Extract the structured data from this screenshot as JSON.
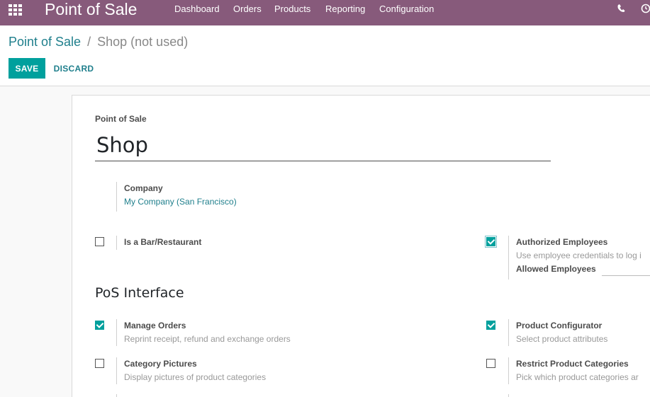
{
  "navbar": {
    "brand": "Point of Sale",
    "menu": [
      "Dashboard",
      "Orders",
      "Products",
      "Reporting",
      "Configuration"
    ],
    "icons": [
      "apps-grid-icon",
      "phone-icon",
      "clock-icon"
    ]
  },
  "breadcrumb": {
    "parent": "Point of Sale",
    "separator": "/",
    "current": "Shop (not used)"
  },
  "actions": {
    "save": "SAVE",
    "discard": "DISCARD"
  },
  "form": {
    "name_label": "Point of Sale",
    "name_value": "Shop",
    "company_label": "Company",
    "company_value": "My Company (San Francisco)",
    "bar_restaurant": {
      "label": "Is a Bar/Restaurant",
      "checked": false
    },
    "authorized_employees": {
      "label": "Authorized Employees",
      "description": "Use employee credentials to log i",
      "checked": true,
      "allowed_label": "Allowed Employees"
    },
    "section_title": "PoS Interface",
    "settings": [
      {
        "title": "Manage Orders",
        "description": "Reprint receipt, refund and exchange orders",
        "checked": true
      },
      {
        "title": "Product Configurator",
        "description": "Select product attributes",
        "checked": true
      },
      {
        "title": "Category Pictures",
        "description": "Display pictures of product categories",
        "checked": false
      },
      {
        "title": "Restrict Product Categories",
        "description": "Pick which product categories ar",
        "checked": false
      }
    ]
  },
  "colors": {
    "navbar": "#875a7b",
    "primary": "#00a09d",
    "link": "#1f7f8c"
  }
}
